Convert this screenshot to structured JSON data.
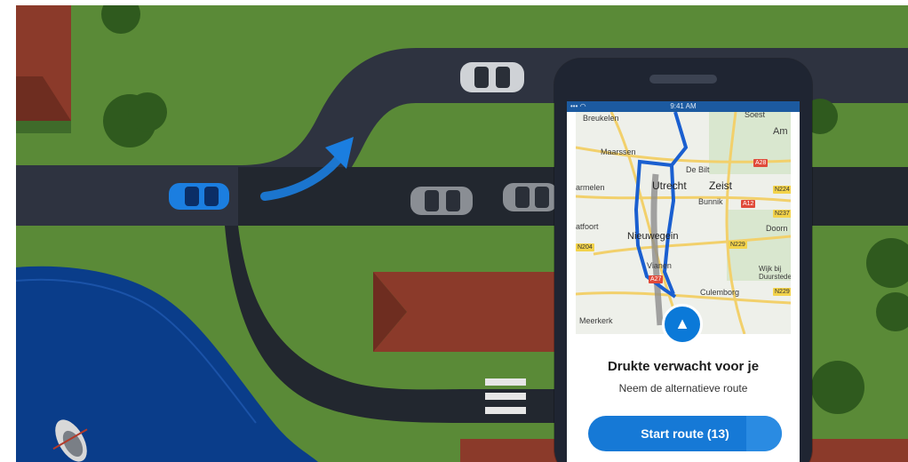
{
  "phone": {
    "time": "9:41 AM",
    "signal": "••• ◠"
  },
  "map": {
    "labels": {
      "breukelen": "Breukelen",
      "soest": "Soest",
      "am": "Am",
      "maarssen": "Maarssen",
      "de_bilt": "De Bilt",
      "a28": "A28",
      "armelen": "armelen",
      "utrecht": "Utrecht",
      "zeist": "Zeist",
      "n224": "N224",
      "bunnik": "Bunnik",
      "a12": "A12",
      "n237": "N237",
      "atfoort": "atfoort",
      "doorn": "Doorn",
      "n204": "N204",
      "nieuwegein": "Nieuwegein",
      "n229a": "N229",
      "vianen": "Vianen",
      "a27": "A27",
      "wijk_bij_duurstede": "Wijk bij\nDuurstede",
      "n229b": "N229",
      "culemborg": "Culemborg",
      "meerkerk": "Meerkerk"
    }
  },
  "card": {
    "title": "Drukte verwacht voor je",
    "subtitle": "Neem de alternatieve route",
    "start_button": "Start route (13)"
  },
  "icons": {
    "nav": "navigation-arrow-icon",
    "arrow": "curved-arrow-icon"
  }
}
